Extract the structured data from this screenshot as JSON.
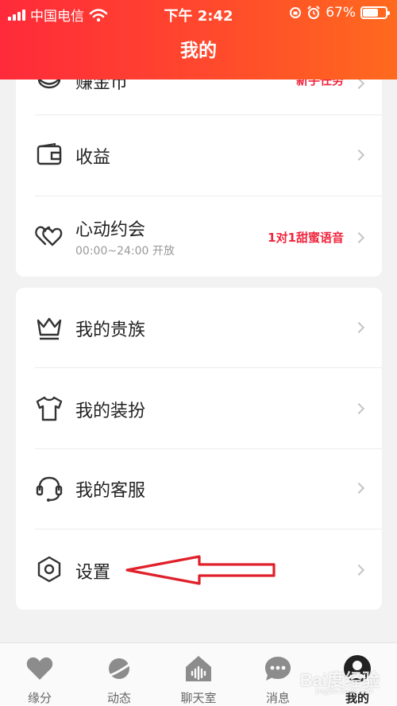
{
  "status_bar": {
    "carrier": "中国电信",
    "time": "下午 2:42",
    "battery_percent": "67%",
    "battery_level": 0.67
  },
  "header": {
    "title": "我的"
  },
  "card1": {
    "items": [
      {
        "label": "赚金币",
        "tag": "新手任务",
        "icon": "coin-icon"
      },
      {
        "label": "收益",
        "icon": "wallet-icon"
      },
      {
        "label": "心动约会",
        "sublabel": "00:00~24:00 开放",
        "tag": "1对1甜蜜语音",
        "icon": "hearts-icon"
      }
    ]
  },
  "card2": {
    "items": [
      {
        "label": "我的贵族",
        "icon": "crown-icon"
      },
      {
        "label": "我的装扮",
        "icon": "shirt-icon"
      },
      {
        "label": "我的客服",
        "icon": "headset-icon"
      },
      {
        "label": "设置",
        "icon": "settings-icon"
      }
    ]
  },
  "annotation": {
    "type": "red-arrow",
    "target": "设置",
    "color": "#e0202a"
  },
  "tabbar": {
    "tabs": [
      {
        "label": "缘分",
        "icon": "heart-icon"
      },
      {
        "label": "动态",
        "icon": "planet-icon"
      },
      {
        "label": "聊天室",
        "icon": "house-wave-icon"
      },
      {
        "label": "消息",
        "icon": "chat-bubble-icon"
      },
      {
        "label": "我的",
        "icon": "avatar-icon",
        "active": true
      }
    ]
  },
  "watermark": {
    "text": "Bai度经验",
    "subtext": "jingyan.baidu.com"
  },
  "colors": {
    "header_start": "#ff2a3a",
    "header_end": "#ff6a1e",
    "accent_tag": "#f0253d",
    "page_bg": "#f2f2f2"
  }
}
